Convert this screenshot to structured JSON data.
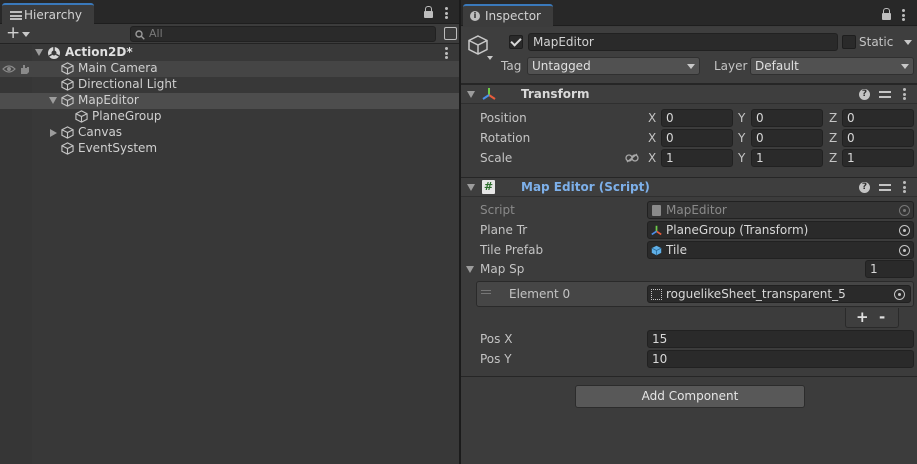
{
  "hierarchy": {
    "tab_label": "Hierarchy",
    "search_placeholder": "All",
    "items": [
      {
        "label": "Action2D*"
      },
      {
        "label": "Main Camera"
      },
      {
        "label": "Directional Light"
      },
      {
        "label": "MapEditor"
      },
      {
        "label": "PlaneGroup"
      },
      {
        "label": "Canvas"
      },
      {
        "label": "EventSystem"
      }
    ]
  },
  "inspector": {
    "tab_label": "Inspector",
    "gameobject": {
      "active": true,
      "name": "MapEditor",
      "static_label": "Static",
      "tag_label": "Tag",
      "tag_value": "Untagged",
      "layer_label": "Layer",
      "layer_value": "Default"
    },
    "transform": {
      "title": "Transform",
      "rows": [
        {
          "label": "Position",
          "x": "0",
          "y": "0",
          "z": "0"
        },
        {
          "label": "Rotation",
          "x": "0",
          "y": "0",
          "z": "0"
        },
        {
          "label": "Scale",
          "x": "1",
          "y": "1",
          "z": "1"
        }
      ],
      "axis_x": "X",
      "axis_y": "Y",
      "axis_z": "Z"
    },
    "script": {
      "title": "Map Editor (Script)",
      "script_label": "Script",
      "script_value": "MapEditor",
      "plane_label": "Plane Tr",
      "plane_value": "PlaneGroup (Transform)",
      "tile_label": "Tile Prefab",
      "tile_value": "Tile",
      "mapsp_label": "Map Sp",
      "mapsp_size": "1",
      "element_label": "Element 0",
      "element_value": "roguelikeSheet_transparent_5",
      "plus": "+",
      "minus": "-",
      "posx_label": "Pos X",
      "posx_value": "15",
      "posy_label": "Pos Y",
      "posy_value": "10"
    },
    "add_component": "Add Component"
  },
  "colors": {
    "accent_tab": "#3a79bb",
    "script_title": "#7db0ea"
  }
}
